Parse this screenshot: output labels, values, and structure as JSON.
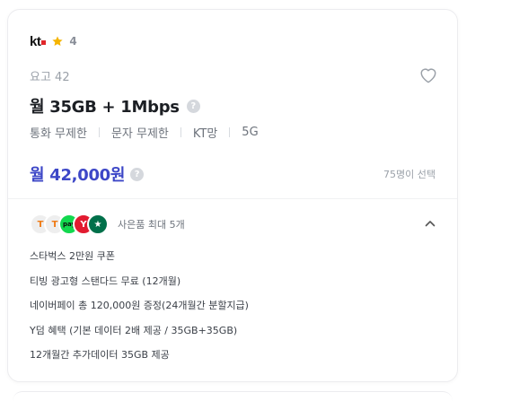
{
  "brand": {
    "name": "kt",
    "rating": "4"
  },
  "plan": {
    "name": "요고 42",
    "title": "월 35GB + 1Mbps",
    "features": [
      "통화 무제한",
      "문자 무제한",
      "KT망",
      "5G"
    ],
    "price": "월 42,000원",
    "selected_count": "75명이 선택"
  },
  "gifts": {
    "label": "사은품 최대 5개",
    "icons": [
      {
        "name": "tving-icon",
        "glyph": "T"
      },
      {
        "name": "tving-icon",
        "glyph": "T"
      },
      {
        "name": "npay-icon",
        "glyph": "pay"
      },
      {
        "name": "ydum-icon",
        "glyph": "Y"
      },
      {
        "name": "starbucks-icon",
        "glyph": "★"
      }
    ],
    "items": [
      "스타벅스 2만원 쿠폰",
      "티빙 광고형 스탠다드 무료 (12개월)",
      "네이버페이 총 120,000원 증정(24개월간 분할지급)",
      "Y덤 혜택 (기본 데이터 2배 제공 / 35GB+35GB)",
      "12개월간 추가데이터 35GB 제공"
    ]
  },
  "colors": {
    "accent": "#3d47c7",
    "star": "#f5b400",
    "kt_red": "#e0262a"
  }
}
